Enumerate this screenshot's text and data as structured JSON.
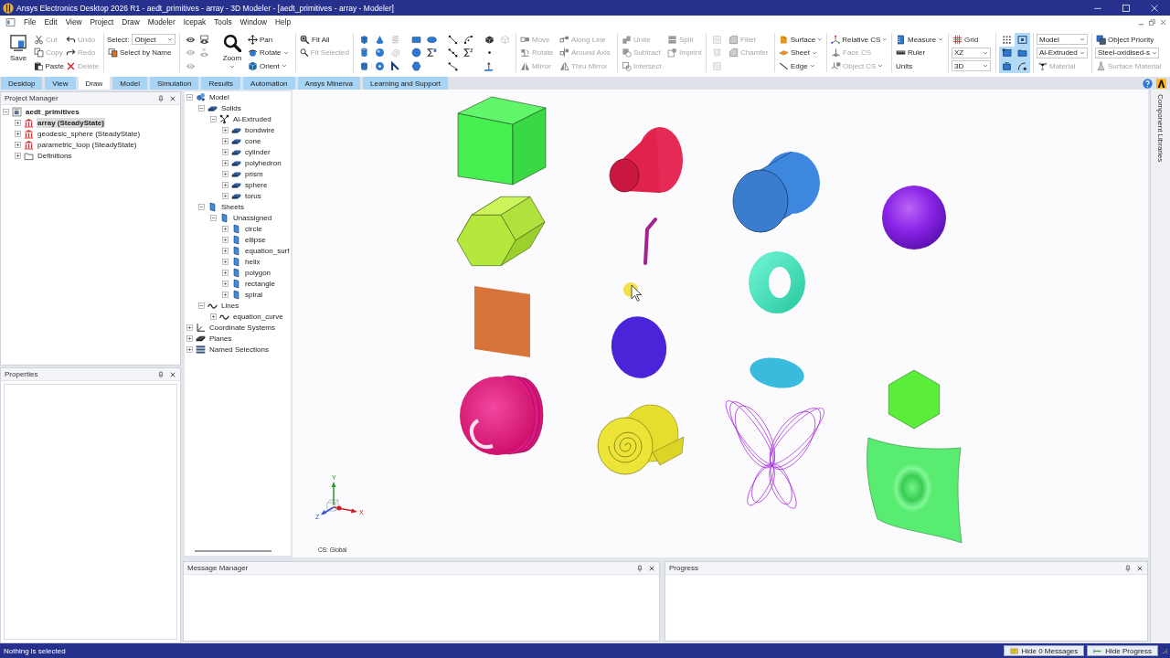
{
  "window": {
    "title": "Ansys Electronics Desktop 2026 R1 - aedt_primitives - array - 3D Modeler - [aedt_primitives - array - Modeler]"
  },
  "menu": [
    "File",
    "Edit",
    "View",
    "Project",
    "Draw",
    "Modeler",
    "Icepak",
    "Tools",
    "Window",
    "Help"
  ],
  "ribbon": {
    "save": {
      "label": "Save"
    },
    "edit": [
      {
        "kind": "cut",
        "label": "Cut",
        "disabled": true
      },
      {
        "kind": "copy",
        "label": "Copy",
        "disabled": true
      },
      {
        "kind": "paste",
        "label": "Paste",
        "disabled": false
      }
    ],
    "history": [
      {
        "kind": "undo",
        "label": "Undo",
        "disabled": true
      },
      {
        "kind": "redo",
        "label": "Redo",
        "disabled": true
      },
      {
        "kind": "delete",
        "label": "Delete",
        "disabled": true
      }
    ],
    "select": {
      "label": "Select:",
      "value": "Object",
      "by_name": "Select by Name"
    },
    "visibility": [
      [
        {
          "kind": "eye",
          "disabled": false
        },
        {
          "kind": "eye",
          "disabled": true
        },
        {
          "kind": "eye",
          "disabled": true
        }
      ],
      [
        {
          "kind": "eye-window",
          "disabled": false
        },
        {
          "kind": "eye-cross",
          "disabled": true
        }
      ]
    ],
    "zoom": {
      "label": "Zoom",
      "dropdown": true
    },
    "navigate": [
      {
        "kind": "pan",
        "label": "Pan",
        "dropdown": false
      },
      {
        "kind": "rotate",
        "label": "Rotate",
        "dropdown": true
      },
      {
        "kind": "orient",
        "label": "Orient",
        "dropdown": true
      }
    ],
    "fit": [
      {
        "kind": "fit-all",
        "label": "Fit All",
        "disabled": false
      },
      {
        "kind": "fit-selected",
        "label": "Fit Selected",
        "disabled": true
      }
    ],
    "draw_tools": [
      [
        {
          "kind": "box",
          "disabled": false
        },
        {
          "kind": "cylinder",
          "disabled": false
        },
        {
          "kind": "polyhedron",
          "disabled": false
        }
      ],
      [
        {
          "kind": "cone",
          "disabled": false
        },
        {
          "kind": "sphere",
          "disabled": false
        },
        {
          "kind": "torus",
          "disabled": false
        }
      ],
      [
        {
          "kind": "helix",
          "disabled": true
        },
        {
          "kind": "spiral",
          "disabled": true
        },
        {
          "kind": "bondwire",
          "disabled": false
        }
      ],
      [
        {
          "kind": "rectangle",
          "disabled": false
        },
        {
          "kind": "circle",
          "disabled": false
        },
        {
          "kind": "polygon",
          "disabled": false
        }
      ],
      [
        {
          "kind": "ellipse",
          "disabled": false
        },
        {
          "kind": "equation-surface",
          "disabled": false
        }
      ],
      [
        {
          "kind": "line",
          "disabled": false
        },
        {
          "kind": "polyline",
          "disabled": false
        },
        {
          "kind": "spline",
          "disabled": false
        }
      ],
      [
        {
          "kind": "arc",
          "disabled": false
        },
        {
          "kind": "equation-curve",
          "disabled": false
        }
      ],
      [
        {
          "kind": "user-defined",
          "disabled": false
        },
        {
          "kind": "point",
          "disabled": false
        },
        {
          "kind": "plane",
          "disabled": false
        }
      ],
      [
        {
          "kind": "solid-outline",
          "disabled": true
        }
      ]
    ],
    "transform": [
      [
        {
          "kind": "move",
          "label": "Move",
          "disabled": true
        },
        {
          "kind": "rotate-object",
          "label": "Rotate",
          "disabled": true
        },
        {
          "kind": "mirror",
          "label": "Mirror",
          "disabled": true
        }
      ],
      [
        {
          "kind": "along-line",
          "label": "Along Line",
          "disabled": true
        },
        {
          "kind": "around-axis",
          "label": "Around Axis",
          "disabled": true
        },
        {
          "kind": "thru-mirror",
          "label": "Thru Mirror",
          "disabled": true
        }
      ]
    ],
    "boolean": [
      [
        {
          "kind": "unite",
          "label": "Unite",
          "disabled": true
        },
        {
          "kind": "subtract",
          "label": "Subtract",
          "disabled": true
        },
        {
          "kind": "intersect",
          "label": "Intersect",
          "disabled": true
        }
      ],
      [
        {
          "kind": "split",
          "label": "Split",
          "disabled": true
        },
        {
          "kind": "imprint",
          "label": "Imprint",
          "disabled": true
        }
      ]
    ],
    "sheet_tools": [
      {
        "kind": "page",
        "disabled": true
      },
      {
        "kind": "cup",
        "disabled": true
      },
      {
        "kind": "page",
        "disabled": true
      }
    ],
    "edges": [
      {
        "kind": "fillet",
        "label": "Fillet",
        "disabled": true
      },
      {
        "kind": "chamfer",
        "label": "Chamfer",
        "disabled": true
      }
    ],
    "create": [
      {
        "kind": "surface",
        "label": "Surface",
        "dropdown": true
      },
      {
        "kind": "sheet",
        "label": "Sheet",
        "dropdown": true
      },
      {
        "kind": "edge",
        "label": "Edge",
        "dropdown": true
      }
    ],
    "cs": [
      {
        "kind": "relative-cs",
        "label": "Relative CS",
        "dropdown": true,
        "disabled": false
      },
      {
        "kind": "face-cs",
        "label": "Face CS",
        "dropdown": false,
        "disabled": true
      },
      {
        "kind": "object-cs",
        "label": "Object CS",
        "dropdown": true,
        "disabled": true
      }
    ],
    "measure": [
      {
        "kind": "measure",
        "label": "Measure",
        "dropdown": true
      },
      {
        "kind": "ruler",
        "label": "Ruler",
        "dropdown": false
      },
      {
        "kind": "units",
        "label": "Units",
        "dropdown": false
      }
    ],
    "grid": {
      "label": "Grid",
      "plane": "XZ",
      "mode": "3D"
    },
    "view_tools": [
      {
        "kind": "grid-dots",
        "on": false
      },
      {
        "kind": "frame-dot",
        "on": true
      },
      {
        "kind": "frame-corner",
        "on": true
      },
      {
        "kind": "frame",
        "on": true
      },
      {
        "kind": "frame-base",
        "on": true
      },
      {
        "kind": "curve",
        "on": true
      }
    ],
    "model": {
      "mode": "Model",
      "assignment": "Al-Extruded",
      "material": {
        "kind": "material",
        "label": "Material",
        "disabled": true
      }
    },
    "priority": {
      "button": {
        "kind": "object-priority",
        "label": "Object Priority",
        "disabled": false
      },
      "material": "Steel-oxidised-s",
      "surface_material": {
        "kind": "surface-material",
        "label": "Surface Material",
        "disabled": true
      }
    }
  },
  "tabs": [
    {
      "label": "Desktop",
      "selected": false
    },
    {
      "label": "View",
      "selected": false
    },
    {
      "label": "Draw",
      "selected": true
    },
    {
      "label": "Model",
      "selected": false
    },
    {
      "label": "Simulation",
      "selected": false
    },
    {
      "label": "Results",
      "selected": false
    },
    {
      "label": "Automation",
      "selected": false
    },
    {
      "label": "Ansys Minerva",
      "selected": false
    },
    {
      "label": "Learning and Support",
      "selected": false
    }
  ],
  "project_manager": {
    "title": "Project Manager",
    "tree": [
      {
        "label": "aedt_primitives",
        "kind": "project",
        "expanded": true,
        "selected": false,
        "children": [
          {
            "label": "array (SteadyState)",
            "kind": "design",
            "expanded": false,
            "selected": true
          },
          {
            "label": "geodesic_sphere (SteadyState)",
            "kind": "design",
            "expanded": false,
            "selected": false
          },
          {
            "label": "parametric_loop (SteadyState)",
            "kind": "design",
            "expanded": false,
            "selected": false
          },
          {
            "label": "Definitions",
            "kind": "folder",
            "expanded": false,
            "selected": false
          }
        ]
      }
    ]
  },
  "model_tree": [
    {
      "label": "Model",
      "kind": "model",
      "expanded": true,
      "children": [
        {
          "label": "Solids",
          "kind": "solid",
          "expanded": true,
          "children": [
            {
              "label": "Al-Extruded",
              "kind": "group",
              "expanded": true,
              "children": [
                {
                  "label": "bondwire",
                  "kind": "solid",
                  "expanded": false
                },
                {
                  "label": "cone",
                  "kind": "solid",
                  "expanded": false
                },
                {
                  "label": "cylinder",
                  "kind": "solid",
                  "expanded": false
                },
                {
                  "label": "polyhedron",
                  "kind": "solid",
                  "expanded": false
                },
                {
                  "label": "prism",
                  "kind": "solid",
                  "expanded": false
                },
                {
                  "label": "sphere",
                  "kind": "solid",
                  "expanded": false
                },
                {
                  "label": "torus",
                  "kind": "solid",
                  "expanded": false
                }
              ]
            }
          ]
        },
        {
          "label": "Sheets",
          "kind": "sheet",
          "expanded": true,
          "children": [
            {
              "label": "Unassigned",
              "kind": "sheet",
              "expanded": true,
              "children": [
                {
                  "label": "circle",
                  "kind": "sheet",
                  "expanded": false
                },
                {
                  "label": "ellipse",
                  "kind": "sheet",
                  "expanded": false
                },
                {
                  "label": "equation_surf",
                  "kind": "sheet",
                  "expanded": false
                },
                {
                  "label": "helix",
                  "kind": "sheet",
                  "expanded": false
                },
                {
                  "label": "polygon",
                  "kind": "sheet",
                  "expanded": false
                },
                {
                  "label": "rectangle",
                  "kind": "sheet",
                  "expanded": false
                },
                {
                  "label": "spiral",
                  "kind": "sheet",
                  "expanded": false
                }
              ]
            }
          ]
        },
        {
          "label": "Lines",
          "kind": "line",
          "expanded": true,
          "children": [
            {
              "label": "equation_curve",
              "kind": "line",
              "expanded": false
            }
          ]
        }
      ]
    },
    {
      "label": "Coordinate Systems",
      "kind": "cs",
      "expanded": false
    },
    {
      "label": "Planes",
      "kind": "planes",
      "expanded": false
    },
    {
      "label": "Named Selections",
      "kind": "selections",
      "expanded": false
    }
  ],
  "properties": {
    "title": "Properties"
  },
  "viewport": {
    "axes": {
      "y": "Y",
      "x": "X",
      "z": "Z"
    },
    "cs": "CS: Global"
  },
  "side_panel": {
    "label": "Component Libraries"
  },
  "message_manager": {
    "title": "Message Manager"
  },
  "progress": {
    "title": "Progress"
  },
  "status_bar": {
    "text": "Nothing is selected",
    "buttons": [
      {
        "kind": "messages",
        "label": "Hide 0 Messages"
      },
      {
        "kind": "progress",
        "label": "Hide Progress"
      }
    ]
  }
}
